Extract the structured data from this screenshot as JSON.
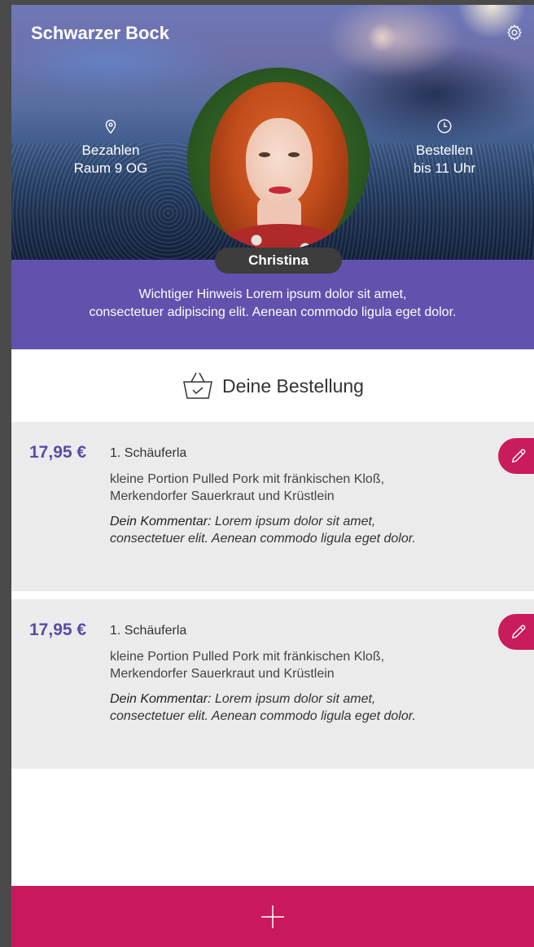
{
  "header": {
    "title": "Schwarzer Bock",
    "settings_icon": "gear-icon",
    "left_info": {
      "icon": "location-pin-icon",
      "line1": "Bezahlen",
      "line2": "Raum 9 OG"
    },
    "right_info": {
      "icon": "clock-icon",
      "line1": "Bestellen",
      "line2": "bis 11 Uhr"
    },
    "user_name": "Christina"
  },
  "notice": {
    "line1": "Wichtiger Hinweis Lorem ipsum dolor sit amet,",
    "line2": "consectetuer adipiscing elit. Aenean commodo ligula eget dolor."
  },
  "section": {
    "icon": "basket-icon",
    "title": "Deine Bestellung"
  },
  "orders": [
    {
      "price": "17,95 €",
      "name": "1. Schäuferla",
      "desc_line1": "kleine Portion Pulled Pork mit fränkischen Kloß,",
      "desc_line2": "Merkendorfer Sauerkraut und Krüstlein",
      "comment_label": "Dein Kommentar:",
      "comment_text": " Lorem ipsum dolor sit amet, consectetuer elit. Aenean commodo ligula eget dolor."
    },
    {
      "price": "17,95 €",
      "name": "1. Schäuferla",
      "desc_line1": "kleine Portion Pulled Pork mit fränkischen Kloß,",
      "desc_line2": "Merkendorfer Sauerkraut und Krüstlein",
      "comment_label": "Dein Kommentar:",
      "comment_text": " Lorem ipsum dolor sit amet, consectetuer elit. Aenean commodo ligula eget dolor."
    }
  ],
  "add_button": {
    "icon": "plus-icon"
  },
  "colors": {
    "accent": "#c8195c",
    "notice": "#6251ad",
    "price": "#5b4aa8"
  }
}
